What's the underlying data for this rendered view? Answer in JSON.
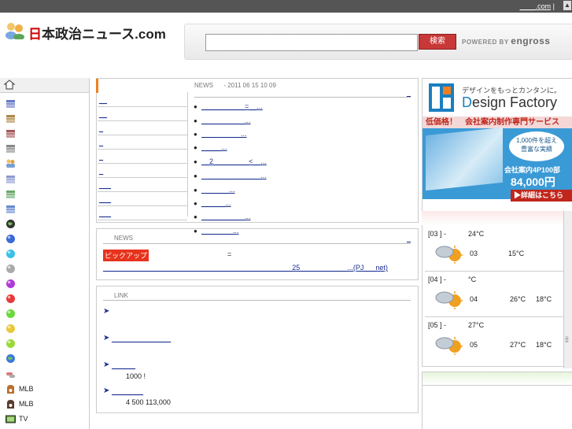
{
  "top": {
    "links": "____.com",
    "sep": "|"
  },
  "header": {
    "logo_red": "日",
    "logo_text": "本政治ニュース.com",
    "search_button": "検索",
    "search_value": "",
    "powered_by": "POWERED BY",
    "powered_brand": "engross"
  },
  "sidebar": {
    "items": [
      {
        "icon": "book-stack-icon",
        "color": "#6a7ac8",
        "label": ""
      },
      {
        "icon": "book-stack-icon",
        "color": "#b0884a",
        "label": ""
      },
      {
        "icon": "book-stack-icon",
        "color": "#a55a5a",
        "label": ""
      },
      {
        "icon": "book-stack-icon",
        "color": "#888888",
        "label": ""
      },
      {
        "icon": "people-icon",
        "color": "#7aa0d0",
        "label": ""
      },
      {
        "icon": "book-icon",
        "color": "#8f9ad0",
        "label": ""
      },
      {
        "icon": "book-icon",
        "color": "#6aa86a",
        "label": ""
      },
      {
        "icon": "book-icon",
        "color": "#6a8ad0",
        "label": ""
      },
      {
        "icon": "globe-icon",
        "color": "#333333",
        "label": ""
      },
      {
        "icon": "ball-icon",
        "color": "#3a6ad8",
        "label": ""
      },
      {
        "icon": "ball-icon",
        "color": "#3ac0e8",
        "label": ""
      },
      {
        "icon": "ball-icon",
        "color": "#aaaaaa",
        "label": ""
      },
      {
        "icon": "ball-icon",
        "color": "#b03ad8",
        "label": ""
      },
      {
        "icon": "ball-icon",
        "color": "#e83a3a",
        "label": ""
      },
      {
        "icon": "ball-icon",
        "color": "#6ad83a",
        "label": ""
      },
      {
        "icon": "ball-icon",
        "color": "#e8c83a",
        "label": ""
      },
      {
        "icon": "ball-icon",
        "color": "#9ad83a",
        "label": ""
      },
      {
        "icon": "earth-icon",
        "color": "#3a7ad8",
        "label": ""
      },
      {
        "icon": "pills-icon",
        "color": "#d87a7a",
        "label": ""
      },
      {
        "icon": "baseball-glove-icon",
        "color": "#b8702a",
        "label": "MLB"
      },
      {
        "icon": "baseball-icon",
        "color": "#5a3a2a",
        "label": "MLB"
      },
      {
        "icon": "tv-icon",
        "color": "#4a7a2a",
        "label": "TV"
      }
    ]
  },
  "nav": {
    "links": [
      "__",
      "__",
      "_",
      "_",
      "_",
      "_",
      "___",
      "___",
      "___"
    ]
  },
  "news1": {
    "head": "NEWS",
    "date": "- 2011 06 15  10 09",
    "more": "_",
    "items": [
      "___________=__...",
      "___________...",
      "__________...",
      "_____...",
      "__2_________<__...",
      "_______________...",
      "_______...",
      "______...",
      "___________...",
      "________..."
    ]
  },
  "news2": {
    "head": "NEWS",
    "more": "_",
    "pickup": "ピックアップ",
    "eq": "=",
    "link": "________________________________________________25____________...(PJ___net)"
  },
  "links": {
    "head": "LINK",
    "items": [
      {
        "link": "",
        "desc": ""
      },
      {
        "link": "_______________",
        "desc": ""
      },
      {
        "link": "______",
        "desc": "1000  !"
      },
      {
        "link": "________",
        "desc": "4  500 113,000"
      }
    ]
  },
  "ad": {
    "slogan": "デザインをもっとカンタンに。",
    "brand_d": "D",
    "brand_rest": "esign Factory",
    "redbar": "低価格！　会社案内制作専門サービス",
    "badge_line1": "1,000件を超え",
    "badge_line2": "豊富な実績",
    "price_label": "会社案内4P100部",
    "price": "84,000円",
    "detail": "▶詳細はこちら"
  },
  "weather": {
    "days": [
      {
        "date": "[03      ]  -",
        "top_temp": "24°C",
        "num": "03",
        "hi": "15°C",
        "lo": ""
      },
      {
        "date": "[04      ]  -",
        "top_temp": "°C",
        "num": "04",
        "hi": "26°C",
        "lo": "18°C"
      },
      {
        "date": "[05      ]  -",
        "top_temp": "27°C",
        "num": "05",
        "hi": "27°C",
        "lo": "18°C"
      }
    ]
  }
}
